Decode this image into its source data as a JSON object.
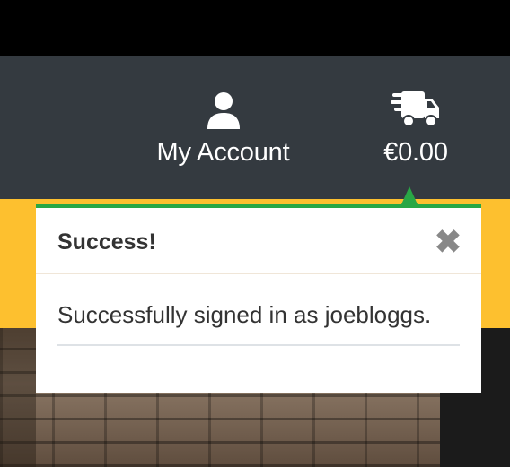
{
  "header": {
    "account": {
      "label": "My Account",
      "icon": "user-icon"
    },
    "cart": {
      "total": "€0.00",
      "icon": "delivery-truck-icon"
    }
  },
  "notification": {
    "title": "Success!",
    "message": "Successfully signed in as joebloggs.",
    "close_symbol": "✖",
    "accent_color": "#28a745"
  },
  "colors": {
    "navbar": "#343a40",
    "band": "#fdc02f"
  }
}
